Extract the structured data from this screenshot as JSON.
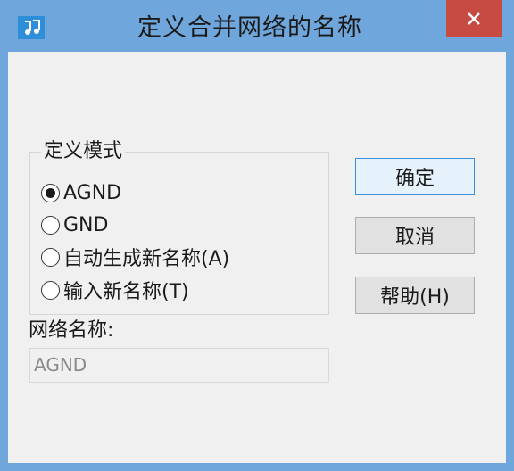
{
  "window": {
    "title": "定义合并网络的名称",
    "close_label": "×"
  },
  "mode_group": {
    "legend": "定义模式",
    "options": [
      {
        "label": "AGND",
        "checked": true
      },
      {
        "label": "GND",
        "checked": false
      },
      {
        "label": "自动生成新名称(A)",
        "checked": false
      },
      {
        "label": "输入新名称(T)",
        "checked": false
      }
    ]
  },
  "net_name": {
    "label": "网络名称:",
    "value": "AGND"
  },
  "buttons": {
    "ok": "确定",
    "cancel": "取消",
    "help": "帮助(H)"
  },
  "colors": {
    "frame": "#6fa6db",
    "close": "#c74a43",
    "client": "#f0f0f0",
    "default_button_border": "#3c8fd9"
  },
  "icons": {
    "app": "music-note-icon",
    "close": "close-icon"
  }
}
